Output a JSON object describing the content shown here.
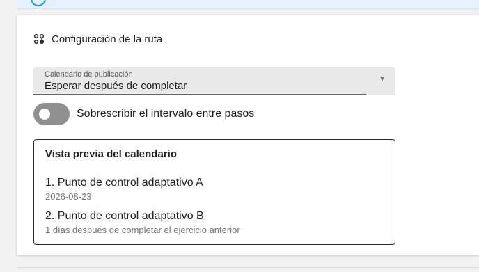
{
  "route_config": {
    "title": "Configuración de la ruta",
    "icon": "route-icon"
  },
  "schedule_select": {
    "label": "Calendario de publicación",
    "value": "Esperar después de completar"
  },
  "override_toggle": {
    "label": "Sobrescribir el intervalo entre pasos",
    "checked": false
  },
  "preview": {
    "title": "Vista previa del calendario",
    "items": [
      {
        "title": "1. Punto de control adaptativo A",
        "subtitle": "2026-08-23"
      },
      {
        "title": "2. Punto de control adaptativo B",
        "subtitle": "1 días después de completar el ejercicio anterior"
      }
    ]
  },
  "colors": {
    "banner_bg": "#e3f2fd",
    "banner_icon": "#2196f3",
    "toggle_track": "#8f8f8f",
    "select_bg": "#e9e9e9"
  }
}
